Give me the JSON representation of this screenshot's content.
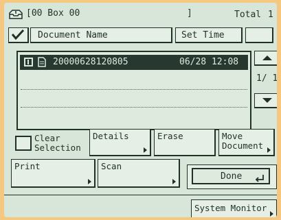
{
  "header": {
    "box_label": "[00 Box 00",
    "box_close": "]",
    "total_label": "Total",
    "total_value": "1"
  },
  "columns": {
    "document_name": "Document Name",
    "set_time": "Set Time"
  },
  "documents": [
    {
      "name": "20000628120805",
      "set_time": "06/28 12:08",
      "selected": true
    }
  ],
  "pager": {
    "page": "1/ 1"
  },
  "buttons": {
    "clear_selection": "Clear\nSelection",
    "details": "Details",
    "erase": "Erase",
    "move_document": "Move\nDocument",
    "print": "Print",
    "scan": "Scan",
    "done": "Done",
    "system_monitor": "System Monitor"
  },
  "icons": {
    "box": "inbox-tray-icon",
    "check": "checkmark-icon",
    "doc_check": "checkbox-icon",
    "doc": "document-icon",
    "up": "scroll-up-icon",
    "down": "scroll-down-icon",
    "return": "return-arrow-icon"
  },
  "colors": {
    "panel_frame": "#f5c882",
    "lcd_background": "#d7e6d8",
    "ink": "#1f3027",
    "highlight_row": "#26382f"
  }
}
